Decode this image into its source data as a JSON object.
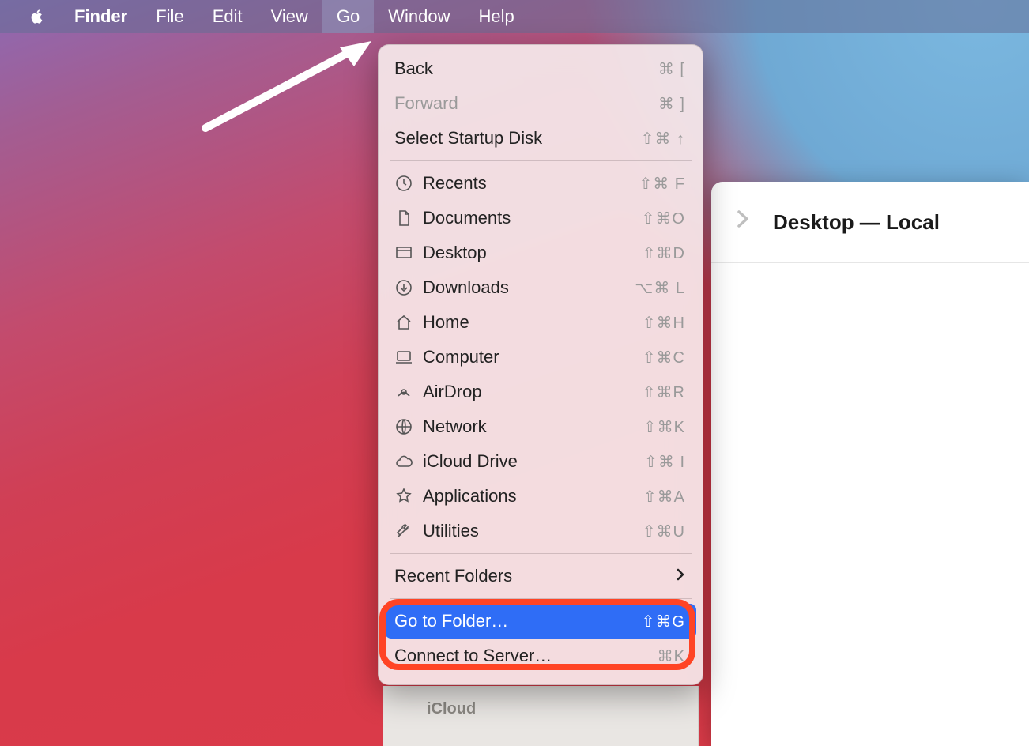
{
  "menubar": {
    "app": "Finder",
    "items": [
      "File",
      "Edit",
      "View",
      "Go",
      "Window",
      "Help"
    ],
    "active_index": 3
  },
  "go_menu": {
    "nav": [
      {
        "label": "Back",
        "shortcut": "⌘ [",
        "disabled": false
      },
      {
        "label": "Forward",
        "shortcut": "⌘ ]",
        "disabled": true
      },
      {
        "label": "Select Startup Disk",
        "shortcut": "⇧⌘ ↑",
        "disabled": false
      }
    ],
    "places": [
      {
        "icon": "clock",
        "label": "Recents",
        "shortcut": "⇧⌘ F"
      },
      {
        "icon": "doc",
        "label": "Documents",
        "shortcut": "⇧⌘O"
      },
      {
        "icon": "desktop",
        "label": "Desktop",
        "shortcut": "⇧⌘D"
      },
      {
        "icon": "download",
        "label": "Downloads",
        "shortcut": "⌥⌘ L"
      },
      {
        "icon": "home",
        "label": "Home",
        "shortcut": "⇧⌘H"
      },
      {
        "icon": "computer",
        "label": "Computer",
        "shortcut": "⇧⌘C"
      },
      {
        "icon": "airdrop",
        "label": "AirDrop",
        "shortcut": "⇧⌘R"
      },
      {
        "icon": "network",
        "label": "Network",
        "shortcut": "⇧⌘K"
      },
      {
        "icon": "icloud",
        "label": "iCloud Drive",
        "shortcut": "⇧⌘ I"
      },
      {
        "icon": "apps",
        "label": "Applications",
        "shortcut": "⇧⌘A"
      },
      {
        "icon": "utilities",
        "label": "Utilities",
        "shortcut": "⇧⌘U"
      }
    ],
    "recent_folders": "Recent Folders",
    "actions": [
      {
        "label": "Go to Folder…",
        "shortcut": "⇧⌘G",
        "selected": true
      },
      {
        "label": "Connect to Server…",
        "shortcut": "⌘K",
        "selected": false
      }
    ]
  },
  "finder_window": {
    "title": "Desktop — Local"
  },
  "sidebar": {
    "section": "iCloud"
  }
}
